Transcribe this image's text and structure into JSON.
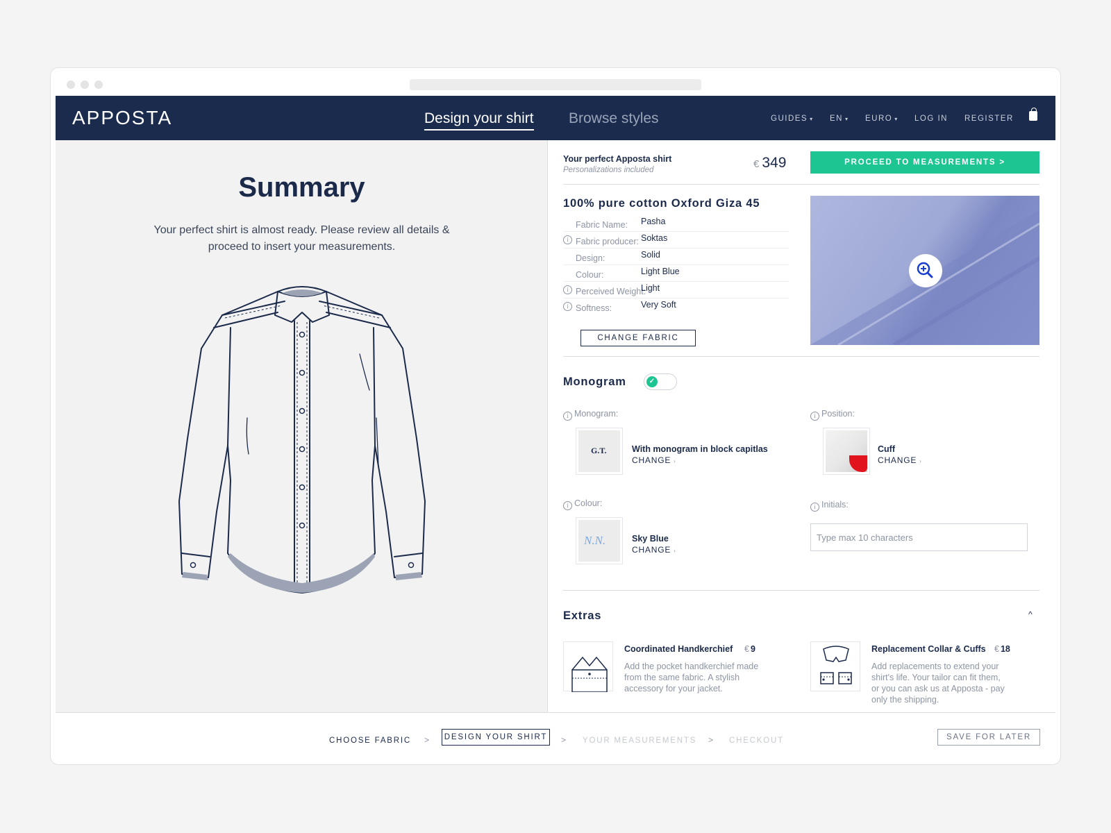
{
  "header": {
    "logo": "APPOSTA",
    "tabs": [
      {
        "label": "Design your shirt",
        "active": true
      },
      {
        "label": "Browse styles",
        "active": false
      }
    ],
    "menu": [
      {
        "label": "GUIDES",
        "dropdown": true
      },
      {
        "label": "EN",
        "dropdown": true
      },
      {
        "label": "EURO",
        "dropdown": true
      },
      {
        "label": "LOG IN",
        "dropdown": false
      },
      {
        "label": "REGISTER",
        "dropdown": false
      }
    ],
    "cart_icon": "shopping-bag-icon"
  },
  "summary": {
    "title": "Summary",
    "text": "Your perfect shirt is almost ready. Please review all details & proceed to insert your measurements."
  },
  "price_box": {
    "title": "Your perfect Apposta shirt",
    "subtitle": "Personalizations included",
    "currency": "€",
    "amount": "349",
    "proceed_label": "PROCEED TO MEASUREMENTS >"
  },
  "fabric": {
    "name": "100% pure cotton Oxford Giza 45",
    "specs": [
      {
        "label": "Fabric Name:",
        "value": "Pasha",
        "info": false
      },
      {
        "label": "Fabric producer:",
        "value": "Soktas",
        "info": true
      },
      {
        "label": "Design:",
        "value": "Solid",
        "info": false
      },
      {
        "label": "Colour:",
        "value": "Light Blue",
        "info": false
      },
      {
        "label": "Perceived Weight:",
        "value": "Light",
        "info": true
      },
      {
        "label": "Softness:",
        "value": "Very Soft",
        "info": true
      }
    ],
    "change_label": "CHANGE FABRIC",
    "zoom_icon": "zoom-in-icon"
  },
  "monogram": {
    "title": "Monogram",
    "enabled": true,
    "style": {
      "label": "Monogram:",
      "thumb_text": "G.T.",
      "value": "With monogram in block capitlas",
      "change": "CHANGE"
    },
    "position": {
      "label": "Position:",
      "value": "Cuff",
      "change": "CHANGE"
    },
    "colour": {
      "label": "Colour:",
      "thumb_text": "N.N.",
      "value": "Sky Blue",
      "change": "CHANGE"
    },
    "initials": {
      "label": "Initials:",
      "placeholder": "Type max 10 characters",
      "value": ""
    }
  },
  "extras": {
    "title": "Extras",
    "items": [
      {
        "title": "Coordinated Handkerchief",
        "currency": "€",
        "price": "9",
        "description": [
          "Add the pocket handkerchief made",
          "from the same fabric. A stylish",
          "accessory for your jacket."
        ]
      },
      {
        "title": "Replacement Collar & Cuffs",
        "currency": "€",
        "price": "18",
        "description": [
          "Add replacements to extend your",
          "shirt's life. Your tailor can fit them,",
          "or you can ask us at Apposta - pay",
          "only the shipping."
        ]
      }
    ]
  },
  "footer": {
    "steps": [
      "CHOOSE FABRIC",
      "DESIGN YOUR SHIRT",
      "YOUR MEASUREMENTS",
      "CHECKOUT"
    ],
    "active_step": "DESIGN YOUR SHIRT",
    "separator": ">",
    "save_label": "SAVE FOR LATER"
  },
  "colors": {
    "navy": "#1b2b4d",
    "accent_green": "#1dc592",
    "muted_text": "#8d94a3",
    "panel_grey": "#f2f2f2",
    "fabric_blue": "#9fa9d6"
  }
}
